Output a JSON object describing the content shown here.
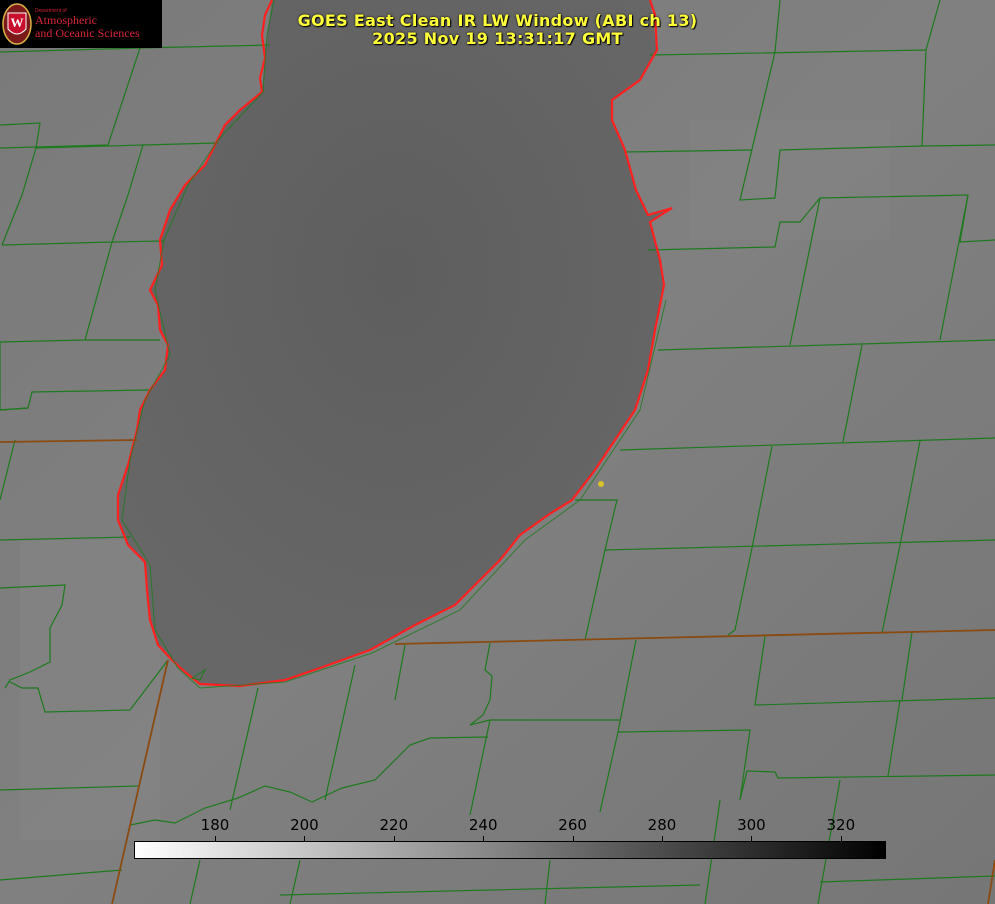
{
  "title": {
    "line1": "GOES East Clean IR LW Window (ABI ch 13)",
    "line2": "2025 Nov 19 13:31:17 GMT"
  },
  "logo": {
    "dept": "Department of",
    "line1": "Atmospheric",
    "line2": "and Oceanic Sciences",
    "seal_letter": "W"
  },
  "colorbar": {
    "ticks": [
      "180",
      "200",
      "220",
      "240",
      "260",
      "280",
      "300",
      "320"
    ],
    "colors": {
      "min": "#ffffff",
      "max": "#000000"
    }
  },
  "colors": {
    "lake_outline": "#ff2020",
    "county_lines": "#1e7a1e",
    "state_lines": "#8a4a10",
    "title": "#ffff3a",
    "station_dot": "#d6c22a"
  }
}
